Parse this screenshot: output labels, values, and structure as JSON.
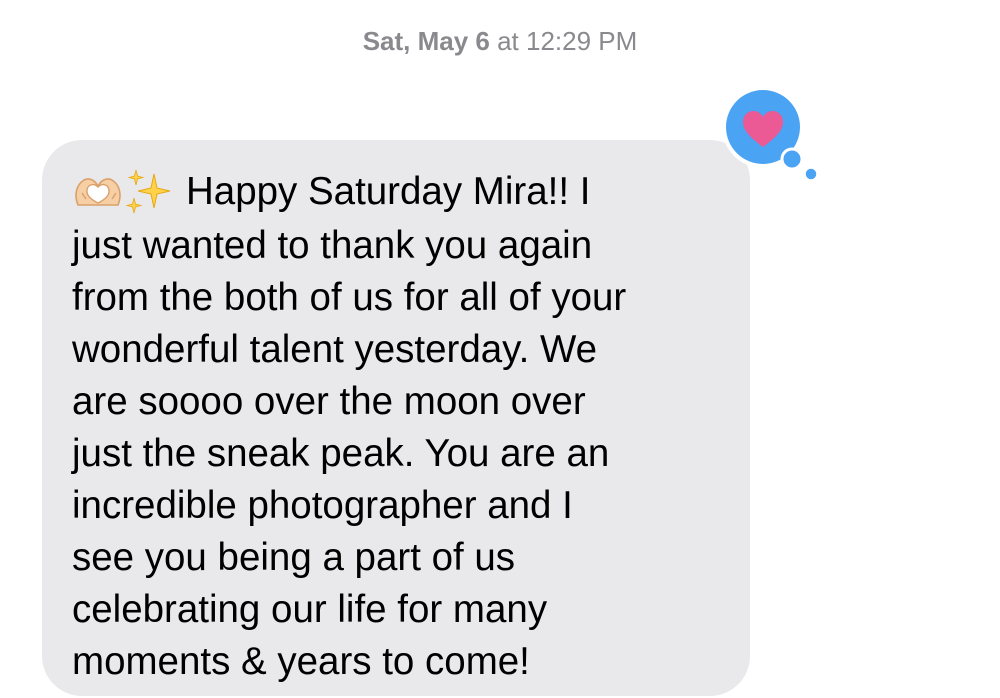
{
  "conversation": {
    "timestamp_day": "Sat, May 6",
    "timestamp_time": " at 12:29 PM"
  },
  "message": {
    "emojis": [
      "heart-hands-emoji",
      "sparkles-emoji"
    ],
    "text": "Happy Saturday Mira!! I\njust wanted to thank you again\nfrom the both of us for all of your\nwonderful talent yesterday. We\nare soooo over the moon over\njust the sneak peak. You are an\nincredible photographer and I\nsee you being a part of us\ncelebrating our life for many\nmoments & years to come!",
    "bubble_color": "#e9e9eb"
  },
  "tapback": {
    "icon": "heart-icon",
    "background_color": "#4aa3f3",
    "heart_color": "#eb5a94"
  }
}
